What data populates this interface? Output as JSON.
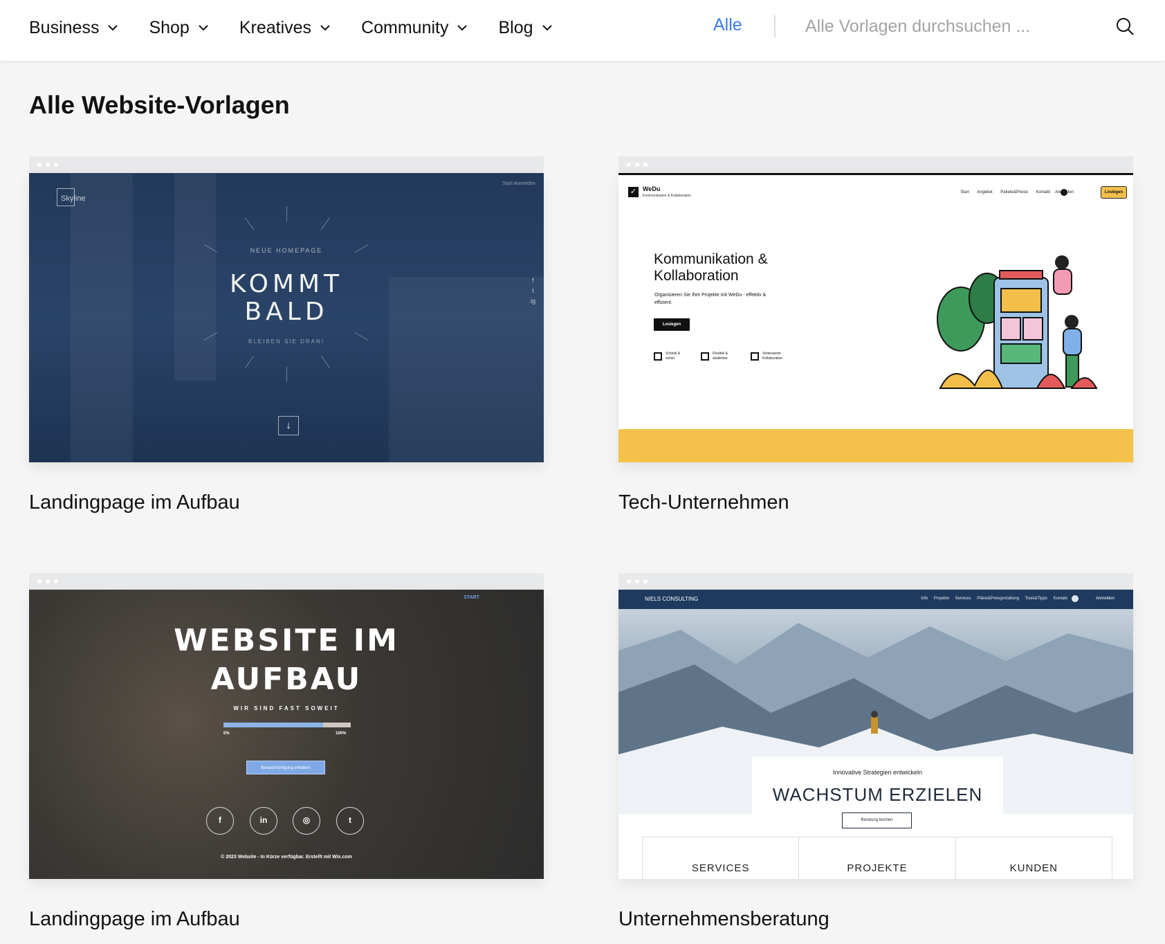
{
  "nav": {
    "items": [
      {
        "label": "Business"
      },
      {
        "label": "Shop"
      },
      {
        "label": "Kreatives"
      },
      {
        "label": "Community"
      },
      {
        "label": "Blog"
      }
    ]
  },
  "filter": {
    "label": "Alle"
  },
  "search": {
    "placeholder": "Alle Vorlagen durchsuchen ..."
  },
  "page": {
    "title": "Alle Website-Vorlagen"
  },
  "colors": {
    "accent": "#3b7ce8",
    "background": "#f4f5f4",
    "wedu_yellow": "#f4c14a",
    "consulting_navy": "#1e3a5e"
  },
  "templates": [
    {
      "caption": "Landingpage im Aufbau",
      "preview": {
        "logo": "Skyline",
        "toplinks": "Start   Anmelden",
        "pretitle": "NEUE HOMEPAGE",
        "title_line1": "KOMMT",
        "title_line2": "BALD",
        "subtitle": "BLEIBEN SIE DRAN!",
        "social": [
          "f",
          "t",
          "ig"
        ],
        "arrow": "↓"
      }
    },
    {
      "caption": "Tech-Unternehmen",
      "preview": {
        "brand": "WeDu",
        "brand_sub": "Kommunikation & Kollaboration",
        "menu": "Start Angebot Pakete&Preise Kontakt",
        "login": "Anmelden",
        "cta": "Loslegen",
        "headline_line1": "Kommunikation &",
        "headline_line2": "Kollaboration",
        "lead": "Organisieren Sie Ihre Projekte mit WeDu - effektiv & effizient.",
        "button": "Loslegen",
        "features": [
          {
            "line1": "Schnell &",
            "line2": "sicher"
          },
          {
            "line1": "Flexibel &",
            "line2": "skalierbar"
          },
          {
            "line1": "Verbesserte",
            "line2": "Kollaboration"
          }
        ]
      }
    },
    {
      "caption": "Landingpage im Aufbau",
      "preview": {
        "start": "START",
        "title_line1": "WEBSITE IM",
        "title_line2": "AUFBAU",
        "tagline": "WIR SIND FAST SOWEIT",
        "progress": 0.78,
        "pct_start": "0%",
        "pct_end": "100%",
        "notify": "Benachrichtigung erhalten!",
        "social": [
          "f",
          "in",
          "◎",
          "t"
        ],
        "footer": "© 2023 Website - In Kürze verfügbar. Erstellt mit Wix.com"
      }
    },
    {
      "caption": "Unternehmensberatung",
      "preview": {
        "name": "NIELS CONSULTING",
        "menu": "Info Projekte Services Pläne&Preisgestaltung Tools&Tipps Kontakt",
        "login": "Anmelden",
        "kicker": "Innovative Strategien entwickeln",
        "title": "WACHSTUM ERZIELEN",
        "button": "Beratung buchen",
        "tabs": [
          "SERVICES",
          "PROJEKTE",
          "KUNDEN"
        ]
      }
    }
  ]
}
